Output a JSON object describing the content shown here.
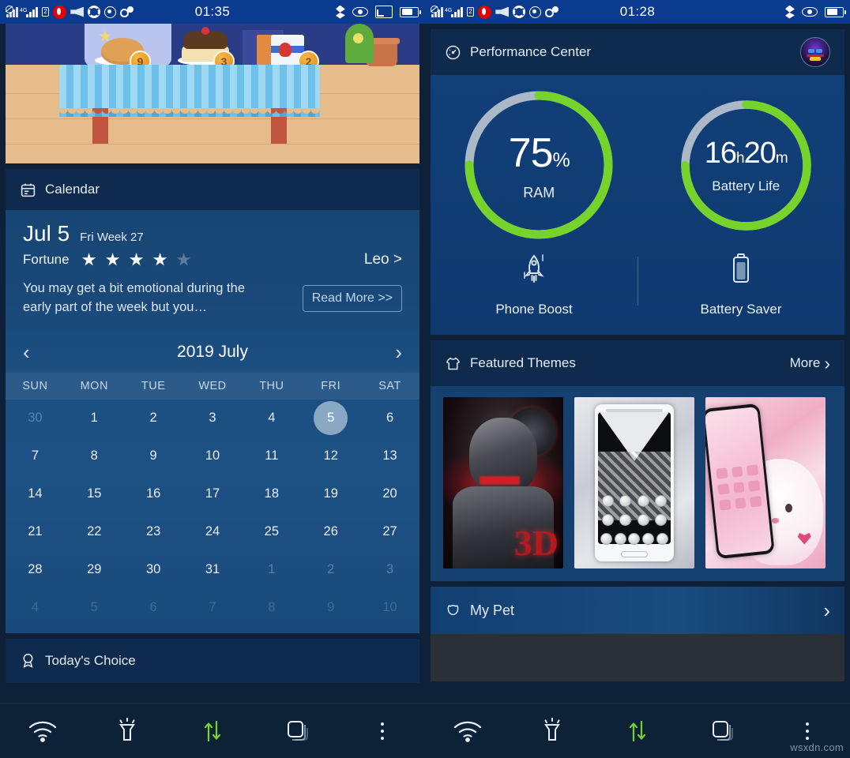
{
  "left_phone": {
    "statusbar": {
      "time": "01:35",
      "left_icons": [
        "signal-no-service-icon",
        "signal-4g-icon",
        "sim2-icon",
        "vodafone-icon",
        "volume-mute-icon",
        "camera-aperture-icon",
        "location-icon",
        "call-forward-icon"
      ],
      "right_icons": [
        "bluetooth-icon",
        "eye-care-icon",
        "screencast-icon",
        "battery-icon"
      ]
    },
    "game_card": {
      "name": "bakery-game-scene",
      "item_badges": [
        "9",
        "3",
        "2"
      ]
    },
    "calendar_card": {
      "title": "Calendar",
      "icon": "calendar-icon"
    },
    "horoscope": {
      "date": "Jul 5",
      "subtitle": "Fri Week 27",
      "fortune_label": "Fortune",
      "stars_filled": 4,
      "stars_total": 5,
      "sign": "Leo >",
      "text": "You may get a bit emotional during the early part of the week but you…",
      "read_more": "Read More >>"
    },
    "calendar": {
      "month_label": "2019 July",
      "prev_icon": "chevron-left-icon",
      "next_icon": "chevron-right-icon",
      "weekdays": [
        "SUN",
        "MON",
        "TUE",
        "WED",
        "THU",
        "FRI",
        "SAT"
      ],
      "today": 5,
      "weeks": [
        [
          {
            "d": "30",
            "t": "prev"
          },
          {
            "d": "1",
            "t": "cur"
          },
          {
            "d": "2",
            "t": "cur"
          },
          {
            "d": "3",
            "t": "cur"
          },
          {
            "d": "4",
            "t": "cur"
          },
          {
            "d": "5",
            "t": "today"
          },
          {
            "d": "6",
            "t": "cur"
          }
        ],
        [
          {
            "d": "7",
            "t": "cur"
          },
          {
            "d": "8",
            "t": "cur"
          },
          {
            "d": "9",
            "t": "cur"
          },
          {
            "d": "10",
            "t": "cur"
          },
          {
            "d": "11",
            "t": "cur"
          },
          {
            "d": "12",
            "t": "cur"
          },
          {
            "d": "13",
            "t": "cur"
          }
        ],
        [
          {
            "d": "14",
            "t": "cur"
          },
          {
            "d": "15",
            "t": "cur"
          },
          {
            "d": "16",
            "t": "cur"
          },
          {
            "d": "17",
            "t": "cur"
          },
          {
            "d": "18",
            "t": "cur"
          },
          {
            "d": "19",
            "t": "cur"
          },
          {
            "d": "20",
            "t": "cur"
          }
        ],
        [
          {
            "d": "21",
            "t": "cur"
          },
          {
            "d": "22",
            "t": "cur"
          },
          {
            "d": "23",
            "t": "cur"
          },
          {
            "d": "24",
            "t": "cur"
          },
          {
            "d": "25",
            "t": "cur"
          },
          {
            "d": "26",
            "t": "cur"
          },
          {
            "d": "27",
            "t": "cur"
          }
        ],
        [
          {
            "d": "28",
            "t": "cur"
          },
          {
            "d": "29",
            "t": "cur"
          },
          {
            "d": "30",
            "t": "cur"
          },
          {
            "d": "31",
            "t": "cur"
          },
          {
            "d": "1",
            "t": "next"
          },
          {
            "d": "2",
            "t": "next"
          },
          {
            "d": "3",
            "t": "next"
          }
        ],
        [
          {
            "d": "4",
            "t": "next2"
          },
          {
            "d": "5",
            "t": "next2"
          },
          {
            "d": "6",
            "t": "next2"
          },
          {
            "d": "7",
            "t": "next2"
          },
          {
            "d": "8",
            "t": "next2"
          },
          {
            "d": "9",
            "t": "next2"
          },
          {
            "d": "10",
            "t": "next2"
          }
        ]
      ]
    },
    "todays_choice": {
      "title": "Today's Choice",
      "icon": "award-ribbon-icon"
    },
    "navbar": [
      "wifi-icon",
      "flashlight-icon",
      "data-transfer-icon",
      "recent-apps-icon",
      "more-options-icon"
    ]
  },
  "right_phone": {
    "statusbar": {
      "time": "01:28",
      "left_icons": [
        "signal-no-service-icon",
        "signal-4g-icon",
        "sim2-icon",
        "vodafone-icon",
        "volume-mute-icon",
        "camera-aperture-icon",
        "location-icon",
        "call-forward-icon"
      ],
      "right_icons": [
        "bluetooth-icon",
        "eye-care-icon",
        "battery-icon"
      ]
    },
    "performance_center": {
      "title": "Performance Center",
      "icon": "speedometer-icon",
      "avatar": "user-avatar",
      "gauges": [
        {
          "name": "ram-gauge",
          "value": "75",
          "unit": "%",
          "label": "RAM",
          "percent": 75,
          "track_color": "#aab8c8",
          "fill_color": "#76d32c"
        },
        {
          "name": "battery-gauge",
          "value_h": "16",
          "unit_h": "h",
          "value_m": "20",
          "unit_m": "m",
          "label": "Battery Life",
          "percent": 75,
          "track_color": "#aab8c8",
          "fill_color": "#76d32c"
        }
      ],
      "actions": [
        {
          "name": "phone-boost",
          "icon": "rocket-icon",
          "label": "Phone Boost"
        },
        {
          "name": "battery-saver",
          "icon": "battery-icon",
          "label": "Battery Saver"
        }
      ]
    },
    "featured_themes": {
      "title": "Featured Themes",
      "icon": "tshirt-icon",
      "more_label": "More",
      "more_icon": "chevron-right-icon",
      "thumbnails": [
        {
          "name": "theme-3d-warrior",
          "caption": "3D"
        },
        {
          "name": "theme-diamond-zipper",
          "caption": ""
        },
        {
          "name": "theme-pink-kitty",
          "caption": ""
        }
      ]
    },
    "my_pet": {
      "title": "My Pet",
      "icon": "pet-bear-icon",
      "chevron": "chevron-right-icon"
    },
    "navbar": [
      "wifi-icon",
      "flashlight-icon",
      "data-transfer-icon",
      "recent-apps-icon",
      "more-options-icon"
    ],
    "watermark": "wsxdn.com"
  },
  "colors": {
    "status_bar": "#0b3b8f",
    "card_header": "#0e2b4d",
    "card_body": "#16406f",
    "accent_green": "#76d32c",
    "gauge_track": "#aab8c8",
    "nav_bg": "#0d2237"
  }
}
